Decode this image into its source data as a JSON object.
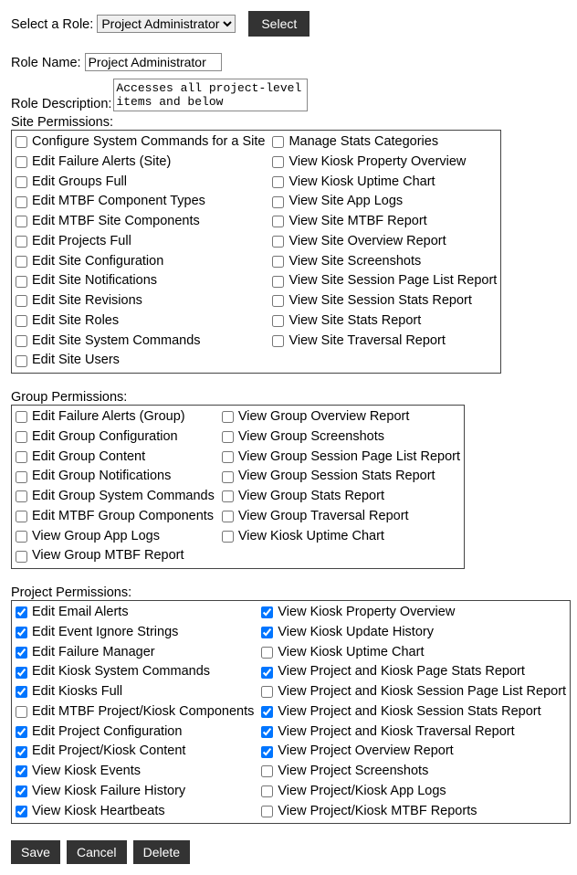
{
  "role_select": {
    "label": "Select a Role:",
    "value": "Project Administrator",
    "button": "Select"
  },
  "role_name": {
    "label": "Role Name:",
    "value": "Project Administrator"
  },
  "role_desc": {
    "label": "Role Description:",
    "value": "Accesses all project-level items and below"
  },
  "site": {
    "title": "Site Permissions:",
    "col1": [
      {
        "l": "Configure System Commands for a Site",
        "c": false
      },
      {
        "l": "Edit Failure Alerts (Site)",
        "c": false
      },
      {
        "l": "Edit Groups Full",
        "c": false
      },
      {
        "l": "Edit MTBF Component Types",
        "c": false
      },
      {
        "l": "Edit MTBF Site Components",
        "c": false
      },
      {
        "l": "Edit Projects Full",
        "c": false
      },
      {
        "l": "Edit Site Configuration",
        "c": false
      },
      {
        "l": "Edit Site Notifications",
        "c": false
      },
      {
        "l": "Edit Site Revisions",
        "c": false
      },
      {
        "l": "Edit Site Roles",
        "c": false
      },
      {
        "l": "Edit Site System Commands",
        "c": false
      },
      {
        "l": "Edit Site Users",
        "c": false
      }
    ],
    "col2": [
      {
        "l": "Manage Stats Categories",
        "c": false
      },
      {
        "l": "View Kiosk Property Overview",
        "c": false
      },
      {
        "l": "View Kiosk Uptime Chart",
        "c": false
      },
      {
        "l": "View Site App Logs",
        "c": false
      },
      {
        "l": "View Site MTBF Report",
        "c": false
      },
      {
        "l": "View Site Overview Report",
        "c": false
      },
      {
        "l": "View Site Screenshots",
        "c": false
      },
      {
        "l": "View Site Session Page List Report",
        "c": false
      },
      {
        "l": "View Site Session Stats Report",
        "c": false
      },
      {
        "l": "View Site Stats Report",
        "c": false
      },
      {
        "l": "View Site Traversal Report",
        "c": false
      }
    ]
  },
  "group": {
    "title": "Group Permissions:",
    "col1": [
      {
        "l": "Edit Failure Alerts (Group)",
        "c": false
      },
      {
        "l": "Edit Group Configuration",
        "c": false
      },
      {
        "l": "Edit Group Content",
        "c": false
      },
      {
        "l": "Edit Group Notifications",
        "c": false
      },
      {
        "l": "Edit Group System Commands",
        "c": false
      },
      {
        "l": "Edit MTBF Group Components",
        "c": false
      },
      {
        "l": "View Group App Logs",
        "c": false
      },
      {
        "l": "View Group MTBF Report",
        "c": false
      }
    ],
    "col2": [
      {
        "l": "View Group Overview Report",
        "c": false
      },
      {
        "l": "View Group Screenshots",
        "c": false
      },
      {
        "l": "View Group Session Page List Report",
        "c": false
      },
      {
        "l": "View Group Session Stats Report",
        "c": false
      },
      {
        "l": "View Group Stats Report",
        "c": false
      },
      {
        "l": "View Group Traversal Report",
        "c": false
      },
      {
        "l": "View Kiosk Uptime Chart",
        "c": false
      }
    ]
  },
  "project": {
    "title": "Project Permissions:",
    "col1": [
      {
        "l": "Edit Email Alerts",
        "c": true
      },
      {
        "l": "Edit Event Ignore Strings",
        "c": true
      },
      {
        "l": "Edit Failure Manager",
        "c": true
      },
      {
        "l": "Edit Kiosk System Commands",
        "c": true
      },
      {
        "l": "Edit Kiosks Full",
        "c": true
      },
      {
        "l": "Edit MTBF Project/Kiosk Components",
        "c": false
      },
      {
        "l": "Edit Project Configuration",
        "c": true
      },
      {
        "l": "Edit Project/Kiosk Content",
        "c": true
      },
      {
        "l": "View Kiosk Events",
        "c": true
      },
      {
        "l": "View Kiosk Failure History",
        "c": true
      },
      {
        "l": "View Kiosk Heartbeats",
        "c": true
      }
    ],
    "col2": [
      {
        "l": "View Kiosk Property Overview",
        "c": true
      },
      {
        "l": "View Kiosk Update History",
        "c": true
      },
      {
        "l": "View Kiosk Uptime Chart",
        "c": false
      },
      {
        "l": "View Project and Kiosk Page Stats Report",
        "c": true
      },
      {
        "l": "View Project and Kiosk Session Page List Report",
        "c": false
      },
      {
        "l": "View Project and Kiosk Session Stats Report",
        "c": true
      },
      {
        "l": "View Project and Kiosk Traversal Report",
        "c": true
      },
      {
        "l": "View Project Overview Report",
        "c": true
      },
      {
        "l": "View Project Screenshots",
        "c": false
      },
      {
        "l": "View Project/Kiosk App Logs",
        "c": false
      },
      {
        "l": "View Project/Kiosk MTBF Reports",
        "c": false
      }
    ]
  },
  "buttons": {
    "save": "Save",
    "cancel": "Cancel",
    "delete": "Delete"
  }
}
